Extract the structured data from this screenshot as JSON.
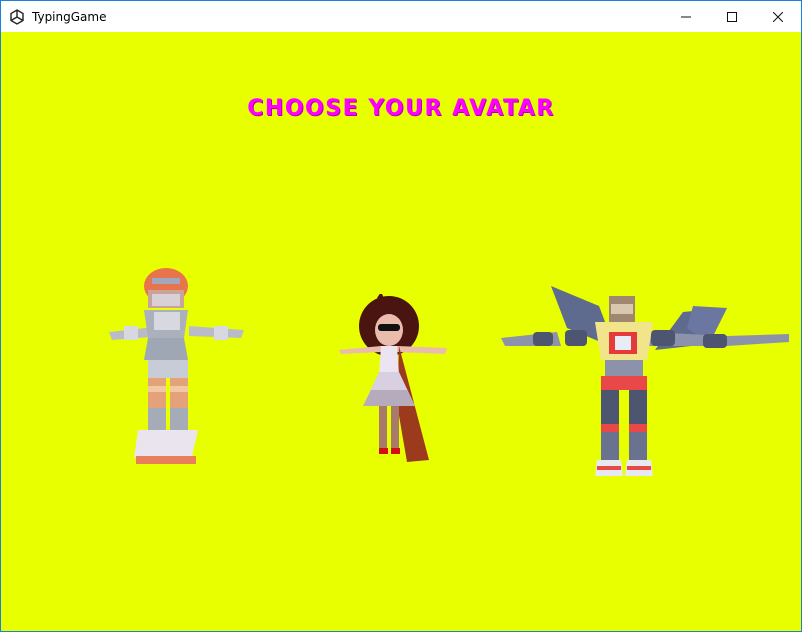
{
  "window": {
    "title": "TypingGame",
    "controls": {
      "minimize": "minimize-icon",
      "maximize": "maximize-icon",
      "close": "close-icon"
    }
  },
  "screen": {
    "heading": "CHOOSE YOUR AVATAR",
    "background_color": "#e8ff00",
    "heading_color": "#ff00ff"
  },
  "avatars": [
    {
      "id": "robot-girl",
      "icon": "robot-avatar"
    },
    {
      "id": "dress-girl",
      "icon": "girl-avatar"
    },
    {
      "id": "winged-robot",
      "icon": "winged-robot-avatar"
    }
  ]
}
